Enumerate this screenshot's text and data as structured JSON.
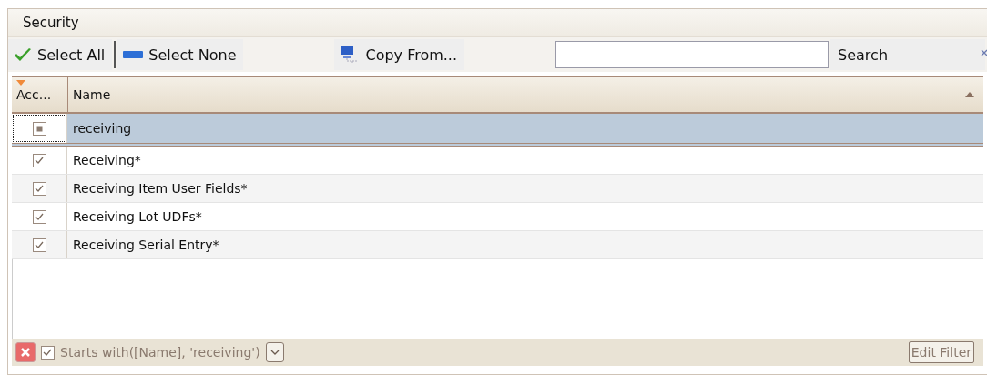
{
  "panel": {
    "title": "Security"
  },
  "toolbar": {
    "select_all": "Select All",
    "select_none": "Select None",
    "copy_from": "Copy From...",
    "search_button": "Search"
  },
  "grid": {
    "columns": [
      {
        "label": "Acc...",
        "sorted": false
      },
      {
        "label": "Name",
        "sorted": true
      }
    ],
    "filter_row": {
      "value": "receiving",
      "indeterminate": true
    },
    "rows": [
      {
        "name": "Receiving*",
        "checked": true
      },
      {
        "name": "Receiving Item User Fields*",
        "checked": true
      },
      {
        "name": "Receiving Lot UDFs*",
        "checked": true
      },
      {
        "name": "Receiving Serial Entry*",
        "checked": true
      }
    ]
  },
  "filter_bar": {
    "enabled": true,
    "expression": "Starts with([Name], 'receiving')",
    "edit_button": "Edit Filter"
  }
}
